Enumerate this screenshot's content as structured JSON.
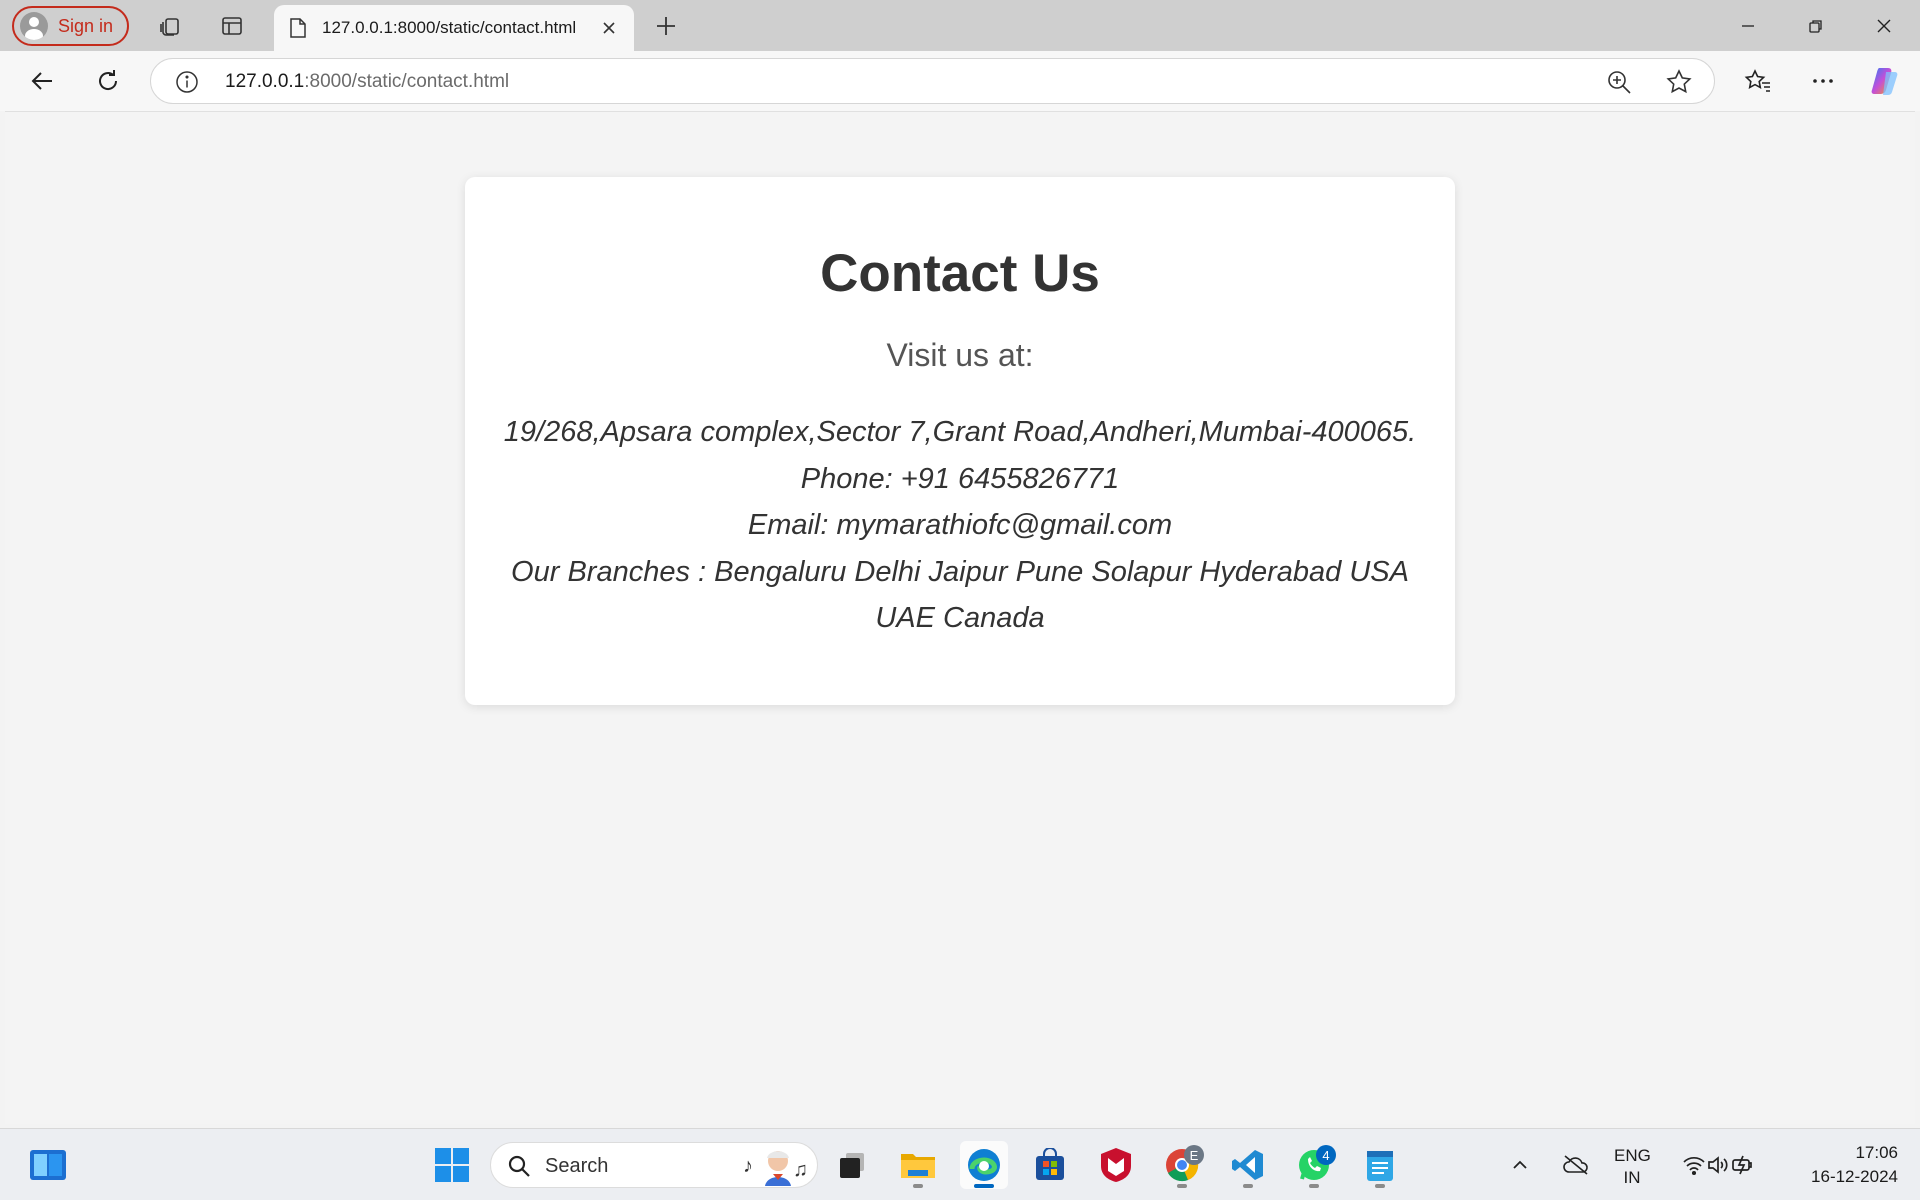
{
  "browser": {
    "sign_in_label": "Sign in",
    "tab": {
      "title": "127.0.0.1:8000/static/contact.html"
    },
    "address_bar": {
      "host": "127.0.0.1",
      "path": ":8000/static/contact.html"
    }
  },
  "page": {
    "heading": "Contact Us",
    "visit_label": "Visit us at:",
    "address": "19/268,Apsara complex,Sector 7,Grant Road,Andheri,Mumbai-400065.",
    "phone": "Phone: +91 6455826771",
    "email": "Email: mymarathiofc@gmail.com",
    "branches": "Our Branches : Bengaluru Delhi Jaipur Pune Solapur Hyderabad USA UAE Canada"
  },
  "taskbar": {
    "search_label": "Search",
    "chrome_badge": "E",
    "whatsapp_badge": "4",
    "language": {
      "line1": "ENG",
      "line2": "IN"
    },
    "time": "17:06",
    "date": "16-12-2024"
  },
  "colors": {
    "signin_red": "#c42b1c",
    "edge_blue": "#0067c0",
    "whatsapp_green": "#25d366"
  }
}
